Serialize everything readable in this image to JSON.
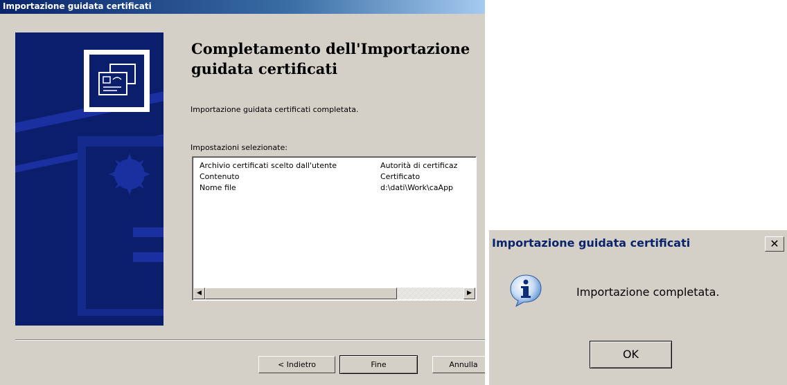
{
  "wizard": {
    "title": "Importazione guidata certificati",
    "heading": "Completamento dell'Importazione guidata certificati",
    "description": "Importazione guidata certificati completata.",
    "settings_label": "Impostazioni selezionate:",
    "settings": [
      {
        "key": "Archivio certificati scelto dall'utente",
        "value": "Autorità di certificaz"
      },
      {
        "key": "Contenuto",
        "value": "Certificato"
      },
      {
        "key": "Nome file",
        "value": "d:\\dati\\Work\\caApp"
      }
    ],
    "buttons": {
      "back": "< Indietro",
      "finish": "Fine",
      "cancel": "Annulla"
    },
    "banner_icon": "certificate-icon",
    "colors": {
      "banner": "#0b1e6b",
      "title_bar": "#0a246a"
    }
  },
  "message_box": {
    "title": "Importazione guidata certificati",
    "close_icon": "close-icon",
    "icon": "info-icon",
    "text": "Importazione completata.",
    "ok_label": "OK"
  }
}
